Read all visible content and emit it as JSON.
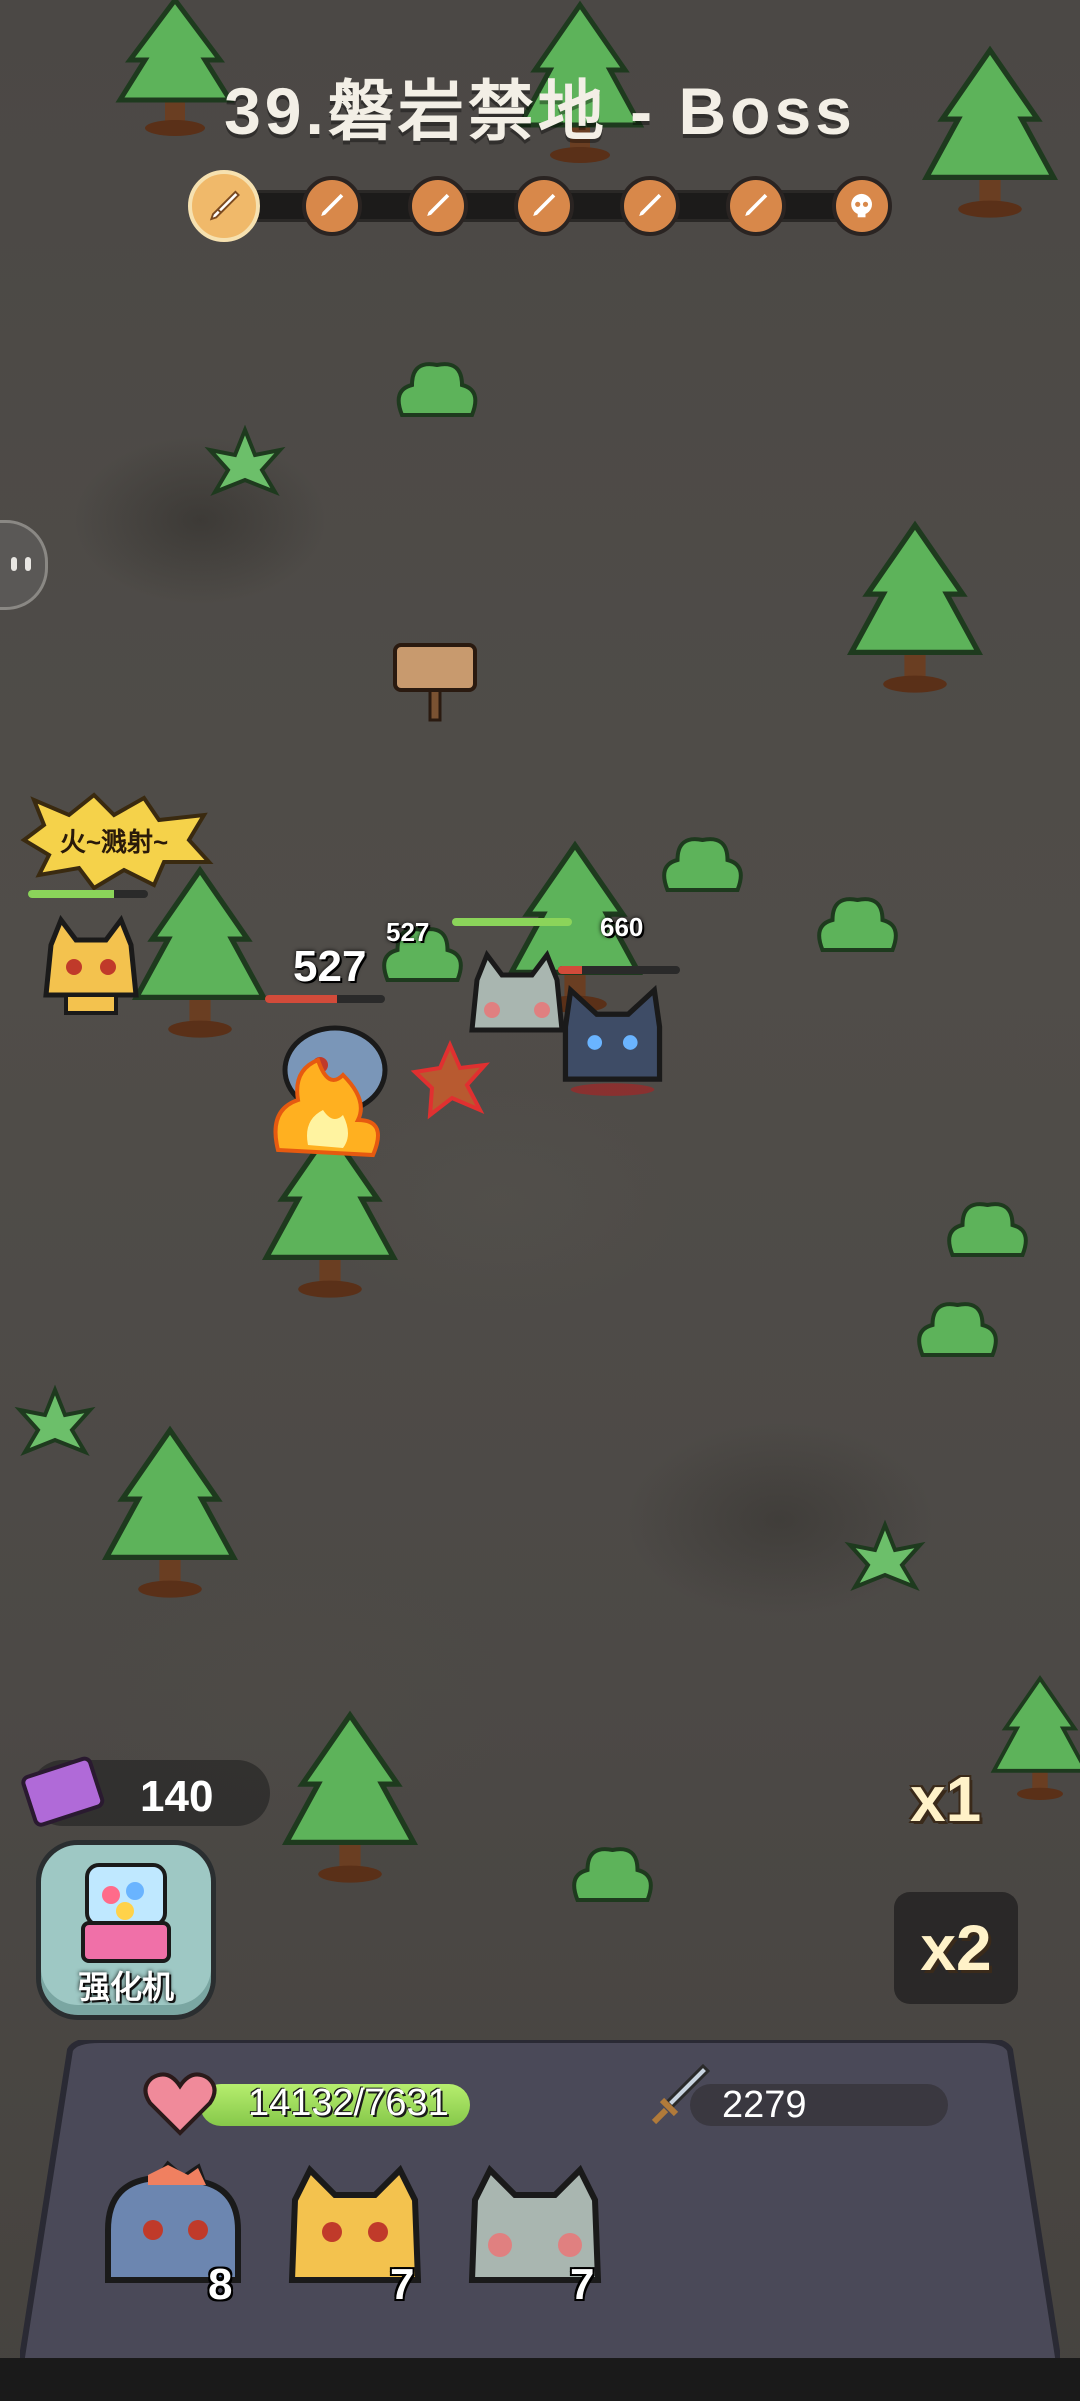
{
  "stage": {
    "title": "39.磐岩禁地 - Boss",
    "progress_nodes": [
      "sword-icon",
      "sword-icon",
      "sword-icon",
      "sword-icon",
      "sword-icon",
      "sword-icon",
      "boss-skull-icon"
    ],
    "current_node": 1
  },
  "battle": {
    "speech_bubble": "火~溅射~",
    "damage_numbers": [
      "527",
      "527",
      "660"
    ],
    "ally_hp_fraction": 0.9,
    "enemy_hp_fraction": 0.6
  },
  "currency": {
    "ticket_icon": "ticket-icon",
    "ticket_count": "140"
  },
  "enhance_button": {
    "label": "强化机",
    "icon": "gacha-machine-icon"
  },
  "speed": {
    "x1_label": "x1",
    "x2_label": "x2"
  },
  "team_panel": {
    "hp_text": "14132/7631",
    "hp_icon": "heart-icon",
    "attack_text": "2279",
    "attack_icon": "sword-icon",
    "members": [
      {
        "name": "dino-hero",
        "level": "8"
      },
      {
        "name": "tiger-cat",
        "level": "7"
      },
      {
        "name": "gray-cat",
        "level": "7"
      }
    ]
  },
  "colors": {
    "ground": "#4b4845",
    "tree": "#5db35a",
    "hp_bar": "#8bd45a",
    "node": "#d8884a",
    "panel": "#4a4958"
  }
}
